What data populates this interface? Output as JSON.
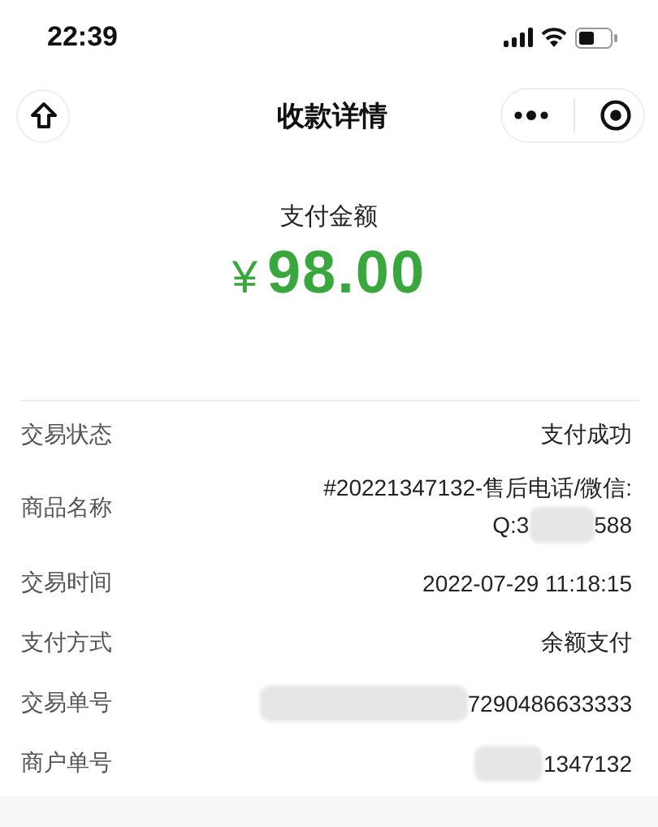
{
  "status_bar": {
    "time": "22:39"
  },
  "nav": {
    "title": "收款详情"
  },
  "amount": {
    "label": "支付金额",
    "currency": "¥",
    "value": "98.00"
  },
  "rows": [
    {
      "label": "交易状态",
      "lines": [
        [
          {
            "kind": "text",
            "text": "支付成功"
          }
        ]
      ]
    },
    {
      "label": "商品名称",
      "lines": [
        [
          {
            "kind": "text",
            "text": "#20221347132-售后电话/微信:"
          }
        ],
        [
          {
            "kind": "text",
            "text": "Q:3"
          },
          {
            "kind": "redacted"
          },
          {
            "kind": "text",
            "text": "588"
          }
        ]
      ]
    },
    {
      "label": "交易时间",
      "lines": [
        [
          {
            "kind": "text",
            "text": "2022-07-29 11:18:15"
          }
        ]
      ]
    },
    {
      "label": "支付方式",
      "lines": [
        [
          {
            "kind": "text",
            "text": "余额支付"
          }
        ]
      ]
    },
    {
      "label": "交易单号",
      "lines": [
        [
          {
            "kind": "redacted"
          },
          {
            "kind": "text",
            "text": "7290486633333"
          }
        ]
      ]
    },
    {
      "label": "商户单号",
      "lines": [
        [
          {
            "kind": "redacted"
          },
          {
            "kind": "text",
            "text": "1347132"
          }
        ]
      ]
    }
  ]
}
